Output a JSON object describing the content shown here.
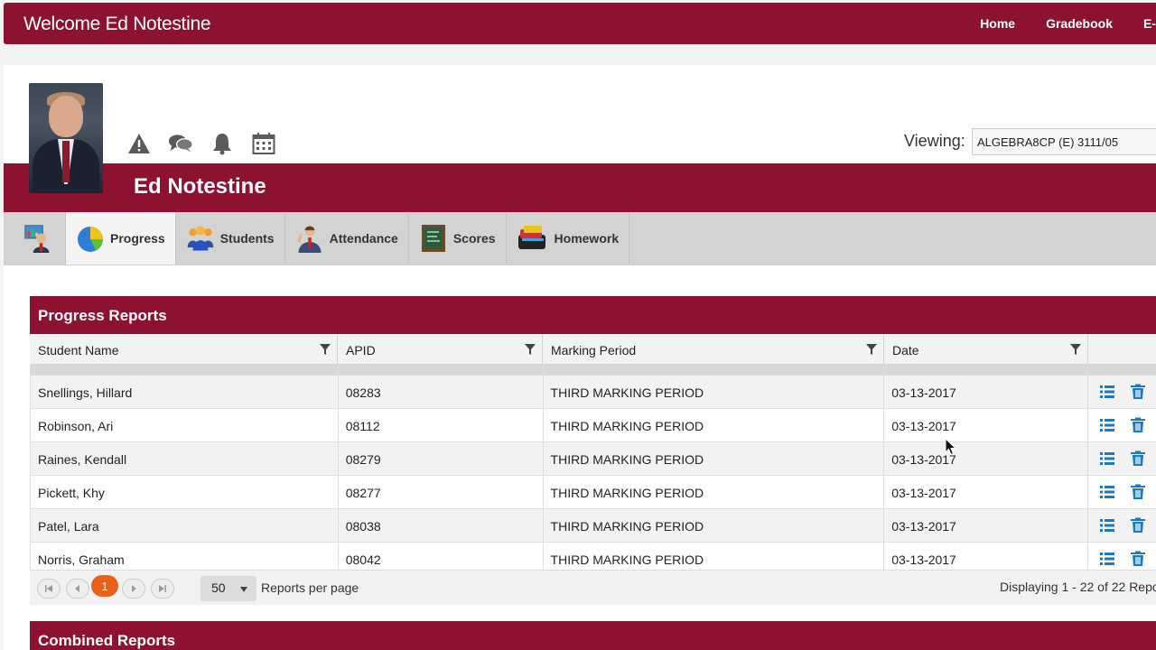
{
  "header": {
    "welcome": "Welcome Ed Notestine",
    "nav": [
      "Home",
      "Gradebook",
      "E-"
    ]
  },
  "profile": {
    "name": "Ed Notestine",
    "icons": [
      "alert-icon",
      "chat-icon",
      "bell-icon",
      "calendar-icon"
    ],
    "viewing_label": "Viewing:",
    "viewing_value": "ALGEBRA8CP (E) 3111/05"
  },
  "tabs": [
    {
      "label": "",
      "icon": "dashboard-icon"
    },
    {
      "label": "Progress",
      "icon": "pie-chart-icon"
    },
    {
      "label": "Students",
      "icon": "students-icon"
    },
    {
      "label": "Attendance",
      "icon": "attendance-icon"
    },
    {
      "label": "Scores",
      "icon": "scores-icon"
    },
    {
      "label": "Homework",
      "icon": "homework-icon"
    }
  ],
  "progress_reports": {
    "title": "Progress Reports",
    "columns": [
      "Student Name",
      "APID",
      "Marking Period",
      "Date"
    ],
    "rows": [
      [
        "Snellings, Hillard",
        "08283",
        "THIRD MARKING PERIOD",
        "03-13-2017"
      ],
      [
        "Robinson, Ari",
        "08112",
        "THIRD MARKING PERIOD",
        "03-13-2017"
      ],
      [
        "Raines, Kendall",
        "08279",
        "THIRD MARKING PERIOD",
        "03-13-2017"
      ],
      [
        "Pickett, Khy",
        "08277",
        "THIRD MARKING PERIOD",
        "03-13-2017"
      ],
      [
        "Patel, Lara",
        "08038",
        "THIRD MARKING PERIOD",
        "03-13-2017"
      ],
      [
        "Norris, Graham",
        "08042",
        "THIRD MARKING PERIOD",
        "03-13-2017"
      ]
    ]
  },
  "pager": {
    "current_page": "1",
    "per_page": "50",
    "per_page_label": "Reports per page",
    "display_text": "Displaying 1 - 22 of 22 Repo"
  },
  "combined_reports": {
    "title": "Combined Reports"
  },
  "colors": {
    "brand": "#8c1230",
    "accent_orange": "#e8601a",
    "action_blue": "#1a7bbf"
  }
}
